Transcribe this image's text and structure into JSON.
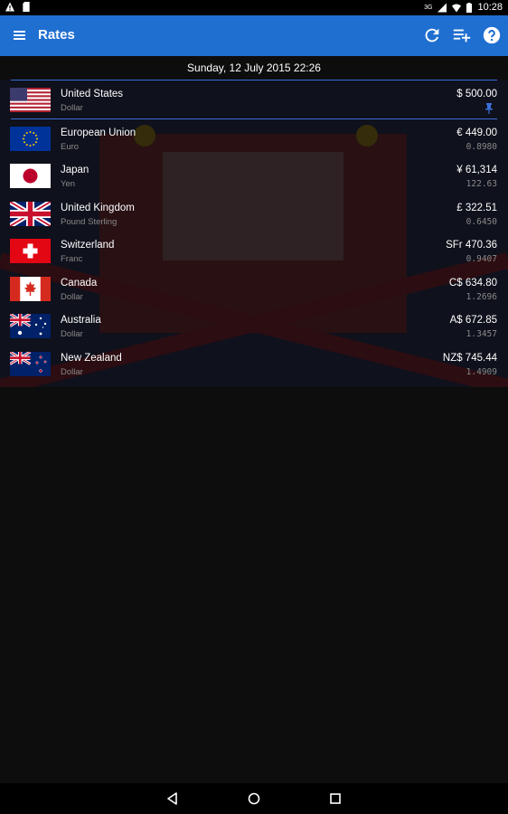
{
  "status_bar": {
    "network": "3G",
    "time": "10:28"
  },
  "app_bar": {
    "title": "Rates"
  },
  "date_header": "Sunday, 12 July 2015 22:26",
  "rates": [
    {
      "country": "United States",
      "currency": "Dollar",
      "amount": "$ 500.00",
      "rate": "",
      "flag": "us-flag",
      "pinned": true
    },
    {
      "country": "European Union",
      "currency": "Euro",
      "amount": "€ 449.00",
      "rate": "0.8980",
      "flag": "eu-flag"
    },
    {
      "country": "Japan",
      "currency": "Yen",
      "amount": "¥ 61,314",
      "rate": "122.63",
      "flag": "jp-flag"
    },
    {
      "country": "United Kingdom",
      "currency": "Pound Sterling",
      "amount": "£ 322.51",
      "rate": "0.6450",
      "flag": "gb-flag"
    },
    {
      "country": "Switzerland",
      "currency": "Franc",
      "amount": "SFr 470.36",
      "rate": "0.9407",
      "flag": "ch-flag"
    },
    {
      "country": "Canada",
      "currency": "Dollar",
      "amount": "C$ 634.80",
      "rate": "1.2696",
      "flag": "ca-flag"
    },
    {
      "country": "Australia",
      "currency": "Dollar",
      "amount": "A$ 672.85",
      "rate": "1.3457",
      "flag": "au-flag"
    },
    {
      "country": "New Zealand",
      "currency": "Dollar",
      "amount": "NZ$ 745.44",
      "rate": "1.4909",
      "flag": "nz-flag"
    }
  ],
  "colors": {
    "app_bar": "#1f6fd1",
    "divider": "#3a6fd8",
    "background": "#0d0d0d"
  }
}
